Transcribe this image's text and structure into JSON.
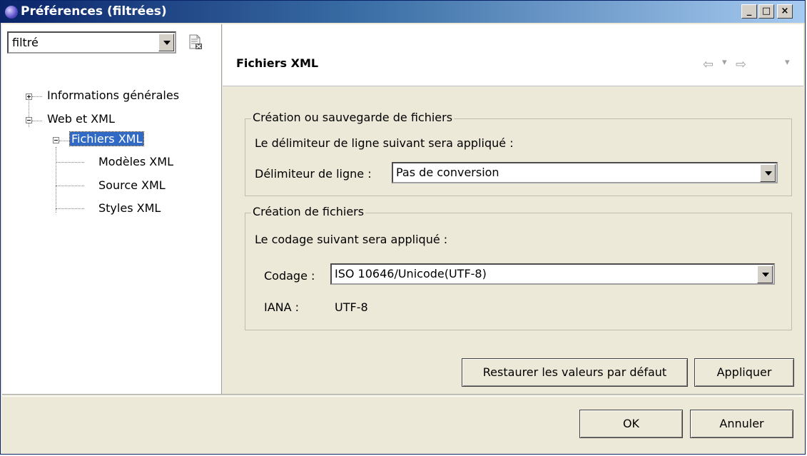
{
  "window": {
    "title": "Préférences (filtrées)",
    "controls": {
      "minimize": "_",
      "maximize": "□",
      "close": "×"
    }
  },
  "filter": {
    "value": "filtré",
    "clear_icon": "clear-filter-icon"
  },
  "tree": {
    "items": [
      {
        "label": "Informations générales",
        "expander": "+"
      },
      {
        "label": "Web et XML",
        "expander": "−"
      },
      {
        "label": "Fichiers XML",
        "expander": "−",
        "selected": true
      },
      {
        "label": "Modèles XML"
      },
      {
        "label": "Source XML"
      },
      {
        "label": "Styles XML"
      }
    ]
  },
  "page": {
    "title": "Fichiers XML",
    "nav": {
      "back": "⇦",
      "back_menu": "▾",
      "forward": "⇨",
      "forward_menu": "▾"
    }
  },
  "group1": {
    "legend": "Création ou sauvegarde de fichiers",
    "description": "Le délimiteur de ligne suivant sera appliqué :",
    "field_label": "Délimiteur de ligne :",
    "field_value": "Pas de conversion"
  },
  "group2": {
    "legend": "Création de fichiers",
    "description": "Le codage suivant sera appliqué :",
    "field_label": "Codage :",
    "field_value": "ISO 10646/Unicode(UTF-8)",
    "iana_label": "IANA :",
    "iana_value": "UTF-8"
  },
  "buttons": {
    "restore": "Restaurer les valeurs par défaut",
    "apply": "Appliquer",
    "ok": "OK",
    "cancel": "Annuler"
  }
}
